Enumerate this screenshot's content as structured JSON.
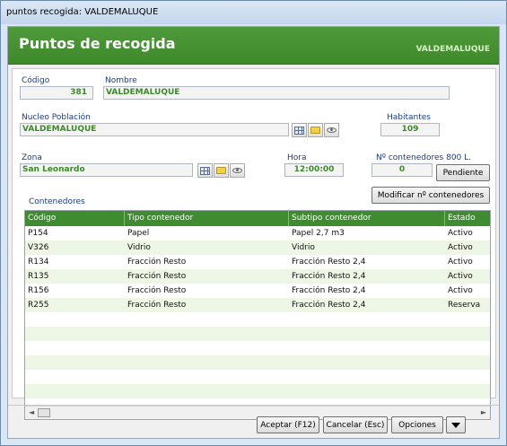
{
  "window": {
    "title": "puntos recogida: VALDEMALUQUE"
  },
  "banner": {
    "title": "Puntos de recogida",
    "subtitle": "VALDEMALUQUE"
  },
  "form": {
    "codigo_label": "Código",
    "codigo_value": "381",
    "nombre_label": "Nombre",
    "nombre_value": "VALDEMALUQUE",
    "nucleo_label": "Nucleo Población",
    "nucleo_value": "VALDEMALUQUE",
    "habitantes_label": "Habitantes",
    "habitantes_value": "109",
    "zona_label": "Zona",
    "zona_value": "San Leonardo",
    "hora_label": "Hora",
    "hora_value": "12:00:00",
    "contenedores800_label": "Nº contenedores 800 L.",
    "contenedores800_value": "0",
    "pendiente_button": "Pendiente",
    "modificar_button": "Modificar nº contenedores",
    "contenedores_label": "Contenedores"
  },
  "table": {
    "columns": [
      "Código",
      "Tipo contenedor",
      "Subtipo contenedor",
      "Estado"
    ],
    "rows": [
      [
        "P154",
        "Papel",
        "Papel 2,7 m3",
        "Activo"
      ],
      [
        "V326",
        "Vidrio",
        "Vidrio",
        "Activo"
      ],
      [
        "R134",
        "Fracción Resto",
        "Fracción Resto 2,4",
        "Activo"
      ],
      [
        "R135",
        "Fracción Resto",
        "Fracción Resto 2,4",
        "Activo"
      ],
      [
        "R156",
        "Fracción Resto",
        "Fracción Resto 2,4",
        "Activo"
      ],
      [
        "R255",
        "Fracción Resto",
        "Fracción Resto 2,4",
        "Reserva"
      ]
    ]
  },
  "footer": {
    "aceptar": "Aceptar (F12)",
    "cancelar": "Cancelar (Esc)",
    "opciones": "Opciones"
  },
  "icons": [
    "grid-icon",
    "folder-icon",
    "eye-icon",
    "dropdown-arrow-icon"
  ]
}
